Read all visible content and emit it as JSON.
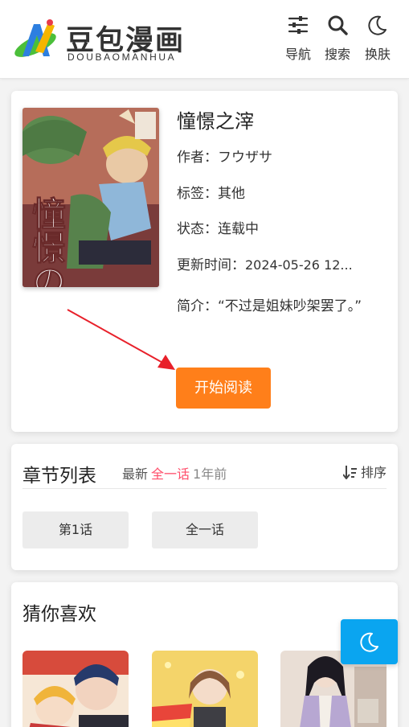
{
  "header": {
    "logo_cn": "豆包漫画",
    "logo_en": "DOUBAOMANHUA",
    "nav": [
      {
        "icon": "sliders-icon",
        "label": "导航"
      },
      {
        "icon": "search-icon",
        "label": "搜索"
      },
      {
        "icon": "moon-icon",
        "label": "换肤"
      }
    ]
  },
  "detail": {
    "title": "憧憬之滓",
    "cover_text": "憧憬の滓",
    "author_key": "作者：",
    "author": "フウザサ",
    "tags_key": "标签：",
    "tags": "其他",
    "status_key": "状态：",
    "status": "连载中",
    "updated_key": "更新时间：",
    "updated": "2024-05-26 12...",
    "intro_key": "简介：",
    "intro": "“不过是姐妹吵架罢了。”",
    "read_button": "开始阅读"
  },
  "chapters": {
    "title": "章节列表",
    "latest_label": "最新",
    "latest_chapter": "全一话",
    "latest_time": "1年前",
    "sort_label": "排序",
    "items": [
      "第1话",
      "全一话"
    ]
  },
  "recommend": {
    "title": "猜你喜欢"
  },
  "colors": {
    "accent_orange": "#ff7f1a",
    "highlight_red": "#ff4d6a",
    "fab_blue": "#0aa5f0"
  }
}
